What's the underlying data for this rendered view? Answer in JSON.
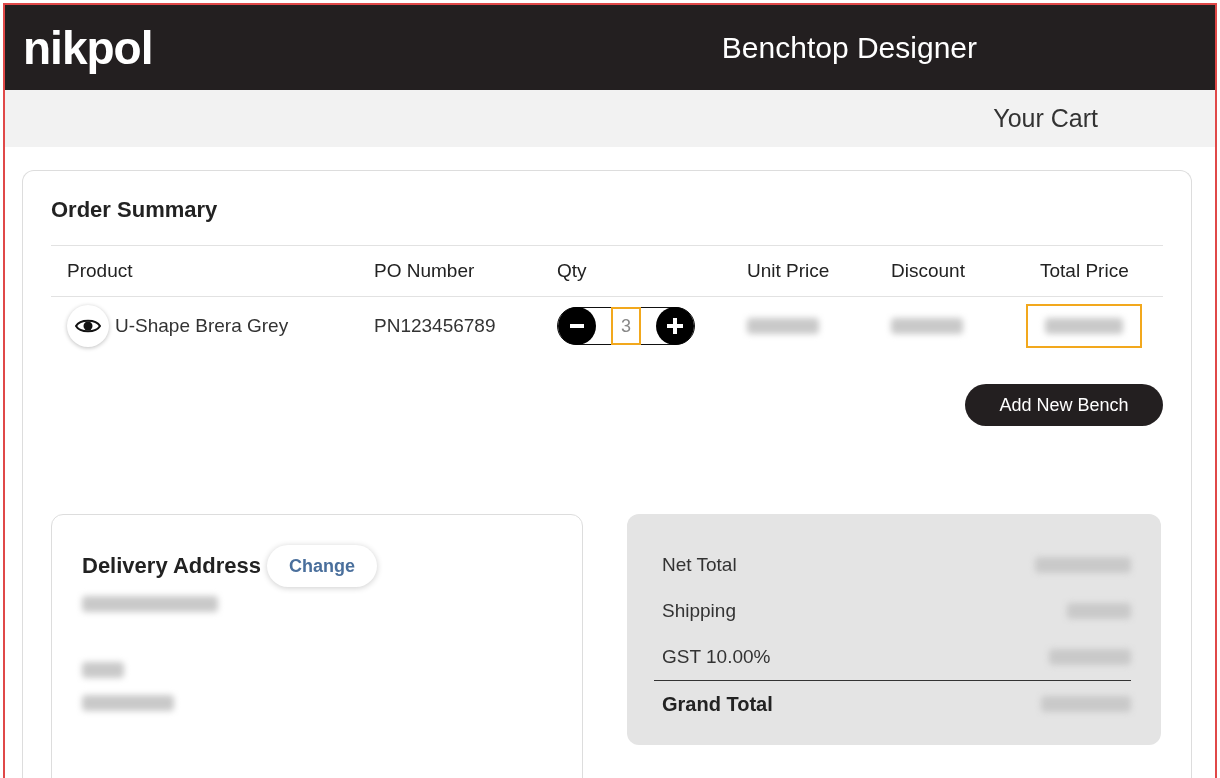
{
  "header": {
    "logo": "nikpol",
    "title": "Benchtop Designer"
  },
  "subheader": {
    "title": "Your Cart"
  },
  "order_summary": {
    "title": "Order Summary",
    "columns": [
      "Product",
      "PO Number",
      "Qty",
      "Unit Price",
      "Discount",
      "Total Price"
    ],
    "rows": [
      {
        "cells": [
          {
            "kind": "product",
            "text": "U-Shape Brera Grey"
          },
          {
            "kind": "text",
            "text": "PN123456789"
          },
          {
            "kind": "stepper",
            "value": "3",
            "highlighted": true
          },
          {
            "kind": "redacted",
            "highlighted": false
          },
          {
            "kind": "redacted",
            "highlighted": false
          },
          {
            "kind": "redacted",
            "highlighted": true
          }
        ]
      }
    ],
    "add_button": "Add New Bench"
  },
  "delivery": {
    "title": "Delivery Address",
    "change_button": "Change",
    "lines": [
      {
        "kind": "redacted"
      },
      {
        "kind": "blank"
      },
      {
        "kind": "redacted"
      },
      {
        "kind": "redacted"
      }
    ]
  },
  "totals": {
    "lines": [
      {
        "label": "Net Total",
        "kind": "normal"
      },
      {
        "label": "Shipping",
        "kind": "normal"
      },
      {
        "label": "GST 10.00%",
        "kind": "normal"
      },
      {
        "label": "Grand Total",
        "kind": "grand"
      }
    ]
  }
}
